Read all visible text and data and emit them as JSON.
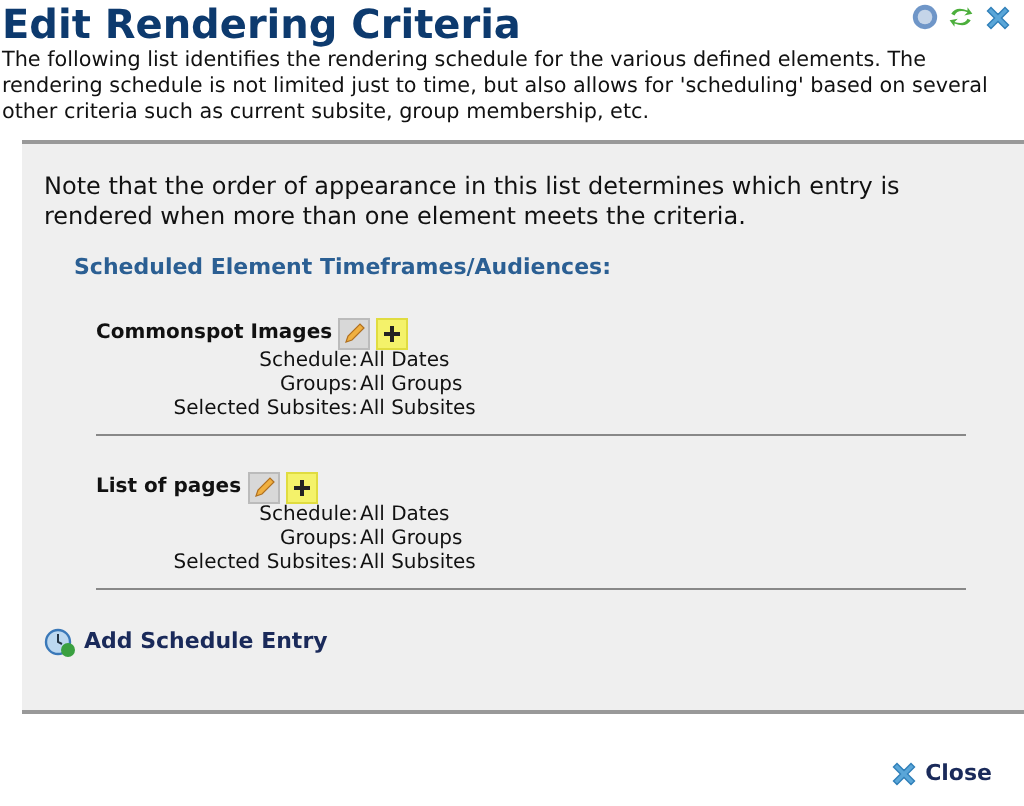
{
  "title": "Edit Rendering Criteria",
  "description": "The following list identifies the rendering schedule for the various defined elements. The rendering schedule is not limited just to time, but also allows for 'scheduling' based on several other criteria such as current subsite, group membership, etc.",
  "note": "Note that the order of appearance in this list determines which entry is rendered when more than one element meets the criteria.",
  "section_heading": "Scheduled Element Timeframes/Audiences:",
  "entries": [
    {
      "name": "Commonspot Images",
      "fields": [
        {
          "label": "Schedule:",
          "value": "All Dates"
        },
        {
          "label": "Groups:",
          "value": "All Groups"
        },
        {
          "label": "Selected Subsites:",
          "value": "All Subsites"
        }
      ]
    },
    {
      "name": "List of pages",
      "fields": [
        {
          "label": "Schedule:",
          "value": "All Dates"
        },
        {
          "label": "Groups:",
          "value": "All Groups"
        },
        {
          "label": "Selected Subsites:",
          "value": "All Subsites"
        }
      ]
    }
  ],
  "add_link": "Add Schedule Entry",
  "close_button": "Close"
}
